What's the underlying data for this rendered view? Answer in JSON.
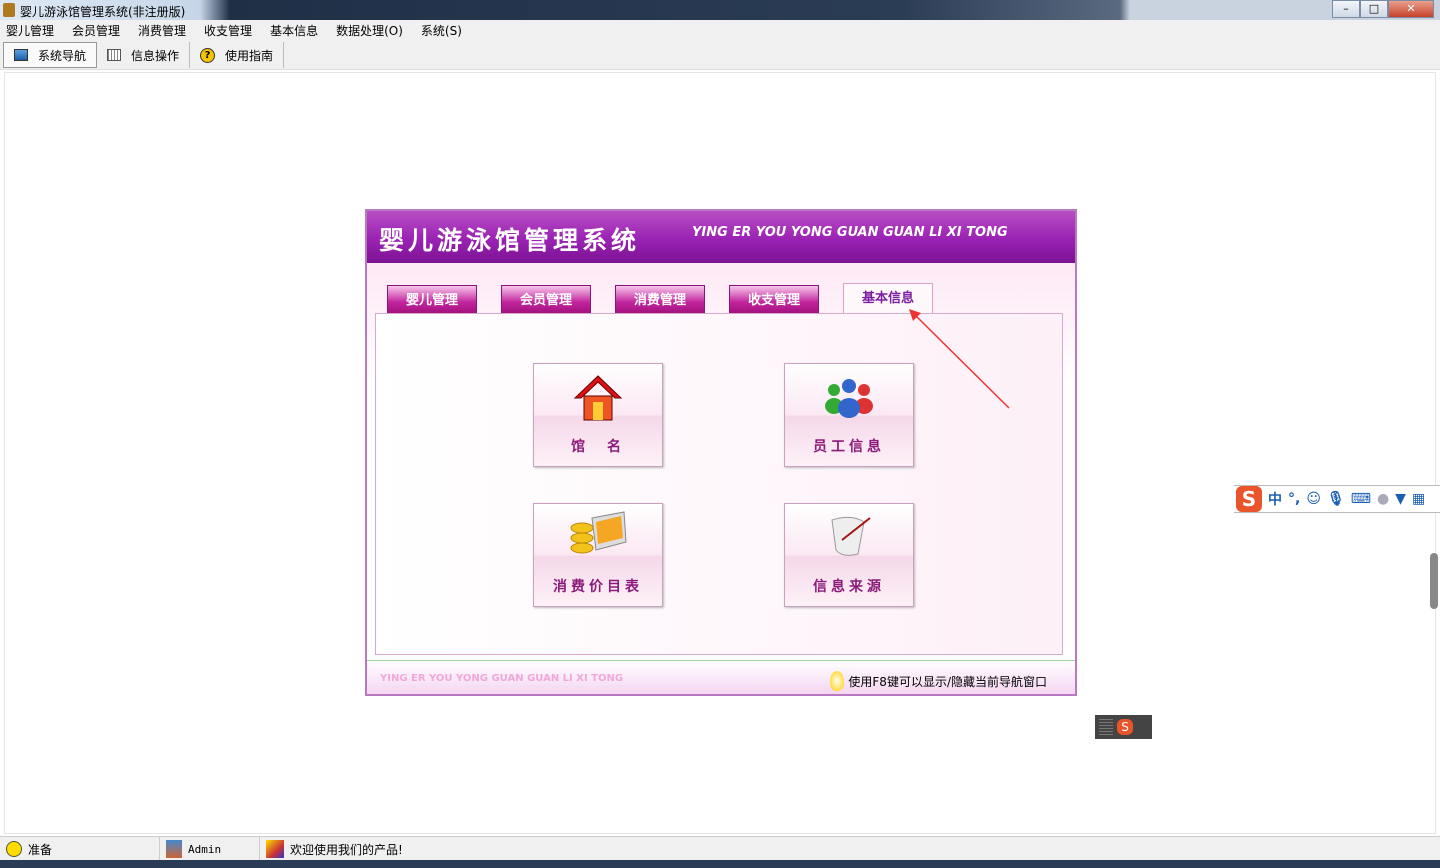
{
  "window": {
    "title": "婴儿游泳馆管理系统(非注册版)"
  },
  "menu": [
    "婴儿管理",
    "会员管理",
    "消费管理",
    "收支管理",
    "基本信息",
    "数据处理(O)",
    "系统(S)"
  ],
  "toolbar": [
    {
      "label": "系统导航",
      "icon": "monitor-icon"
    },
    {
      "label": "信息操作",
      "icon": "grid-icon"
    },
    {
      "label": "使用指南",
      "icon": "help-icon"
    }
  ],
  "panel": {
    "title": "婴儿游泳馆管理系统",
    "subtitle": "YING ER YOU YONG GUAN GUAN LI XI TONG",
    "tabs": [
      "婴儿管理",
      "会员管理",
      "消费管理",
      "收支管理",
      "基本信息"
    ],
    "selected_tab": "基本信息",
    "buttons": [
      {
        "label": "馆　名",
        "icon": "house-icon"
      },
      {
        "label": "员工信息",
        "icon": "people-icon"
      },
      {
        "label": "消费价目表",
        "icon": "coins-laptop-icon"
      },
      {
        "label": "信息来源",
        "icon": "scroll-icon"
      }
    ],
    "footer_en": "YING ER YOU YONG GUAN GUAN LI XI TONG",
    "footer_tip": "使用F8键可以显示/隐藏当前导航窗口"
  },
  "ime": {
    "mode": "中",
    "punct": "°,"
  },
  "status": {
    "state": "准备",
    "user": "Admin",
    "message": "欢迎使用我们的产品!"
  },
  "colors": {
    "accent": "#9a22b3",
    "tab": "#c2259e",
    "label": "#8b1a7b"
  }
}
